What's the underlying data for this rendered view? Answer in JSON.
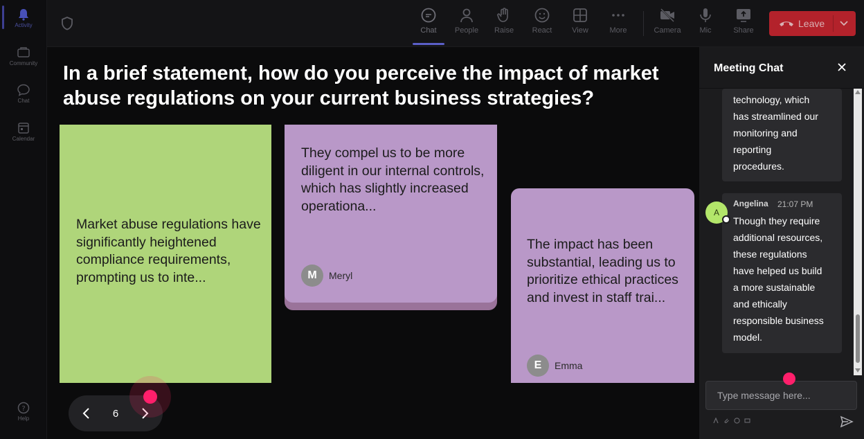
{
  "rail": {
    "items": [
      {
        "label": "Activity",
        "active": true
      },
      {
        "label": "Community"
      },
      {
        "label": "Chat"
      },
      {
        "label": "Calendar"
      }
    ],
    "help": "Help"
  },
  "toolbar": {
    "items": [
      "Chat",
      "People",
      "Raise",
      "React",
      "View",
      "More",
      "Camera",
      "Mic",
      "Share"
    ],
    "active": "Chat",
    "leave_label": "Leave"
  },
  "question": "In a brief statement, how do you perceive the impact of market abuse regulations on your current business strategies?",
  "notes": [
    {
      "text": "Market abuse regulations have significantly heightened compliance requirements, prompting us to inte...",
      "author": "",
      "initial": "",
      "color": "#afd57a"
    },
    {
      "text": "They compel us to be more diligent in our internal controls, which has slightly increased operationa...",
      "author": "Meryl",
      "initial": "M",
      "color": "#b998c8"
    },
    {
      "text": "The impact has been substantial, leading us to prioritize ethical practices and invest in staff trai...",
      "author": "Emma",
      "initial": "E",
      "color": "#b998c8"
    }
  ],
  "pager": {
    "page": "6"
  },
  "chat": {
    "title": "Meeting Chat",
    "messages": [
      {
        "author": "",
        "time": "",
        "lines": [
          "technology, which",
          "has streamlined our",
          "monitoring and",
          "reporting",
          "procedures."
        ]
      },
      {
        "author": "Angelina",
        "initial": "A",
        "time": "21:07 PM",
        "lines": [
          "Though they require",
          "additional resources,",
          "these regulations",
          "have helped us build",
          "a more sustainable",
          "and ethically",
          "responsible business",
          "model."
        ]
      }
    ],
    "input_placeholder": "Type message here..."
  },
  "colors": {
    "accent": "#5b5fc7",
    "leave": "#b3222b",
    "cursor": "#ff1f6b",
    "avatar_green": "#b3e66a"
  }
}
